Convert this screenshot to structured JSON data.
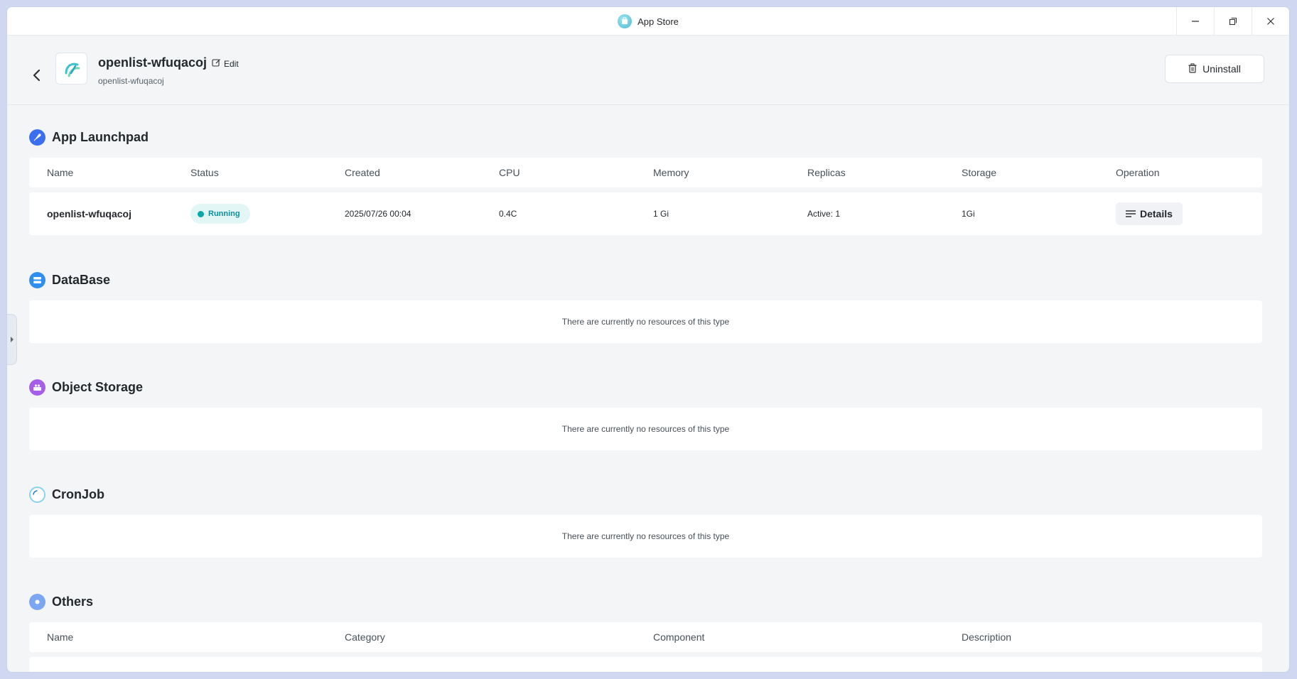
{
  "window": {
    "title": "App Store"
  },
  "header": {
    "app_name": "openlist-wfuqacoj",
    "edit_label": "Edit",
    "app_subtitle": "openlist-wfuqacoj",
    "uninstall_label": "Uninstall"
  },
  "launchpad": {
    "title": "App Launchpad",
    "columns": [
      "Name",
      "Status",
      "Created",
      "CPU",
      "Memory",
      "Replicas",
      "Storage",
      "Operation"
    ],
    "row": {
      "name": "openlist-wfuqacoj",
      "status": "Running",
      "created": "2025/07/26 00:04",
      "cpu": "0.4C",
      "memory": "1 Gi",
      "replicas": "Active: 1",
      "storage": "1Gi",
      "operation": "Details"
    }
  },
  "database": {
    "title": "DataBase",
    "empty": "There are currently no resources of this type"
  },
  "object_storage": {
    "title": "Object Storage",
    "empty": "There are currently no resources of this type"
  },
  "cronjob": {
    "title": "CronJob",
    "empty": "There are currently no resources of this type"
  },
  "others": {
    "title": "Others",
    "columns": [
      "Name",
      "Category",
      "Component",
      "Description"
    ]
  },
  "colors": {
    "accent": "#0aa6a8",
    "background": "#f3f5f7"
  }
}
